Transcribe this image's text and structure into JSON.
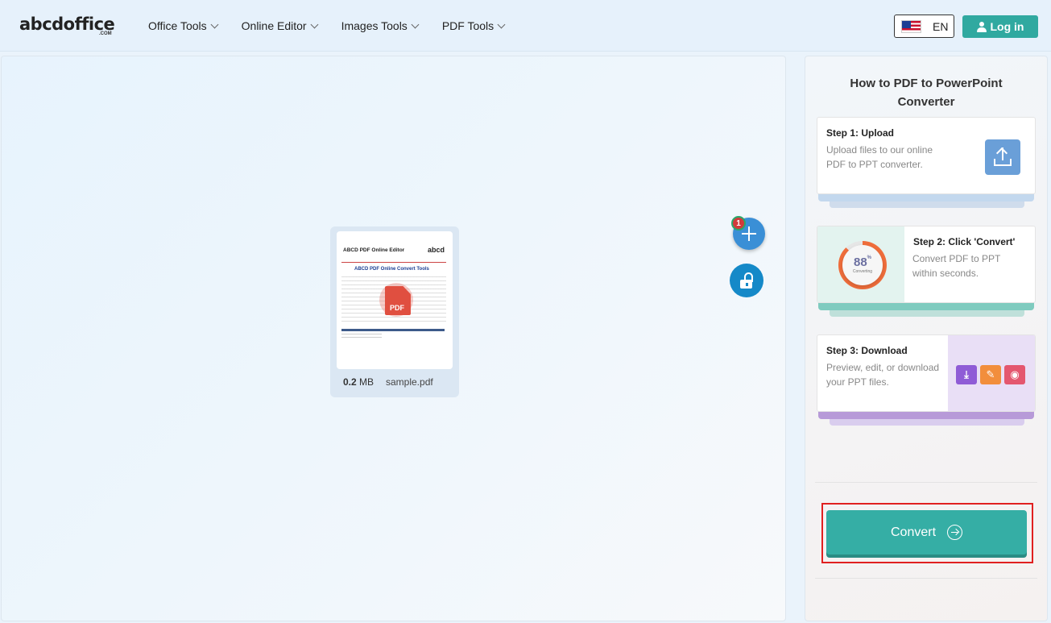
{
  "header": {
    "logo": "abcdoffice",
    "logo_suffix": ".COM",
    "nav": [
      "Office Tools",
      "Online Editor",
      "Images Tools",
      "PDF Tools"
    ],
    "language": "EN",
    "login_label": "Log in"
  },
  "workspace": {
    "file": {
      "size_value": "0.2",
      "size_unit": "MB",
      "name": "sample.pdf",
      "badge_label": "PDF",
      "thumbnail": {
        "heading": "ABCD PDF Online Editor",
        "logo": "abcd",
        "subheading": "ABCD PDF Online Convert Tools"
      }
    },
    "file_count_badge": "1",
    "add_icon": "plus-icon",
    "lock_icon": "unlock-icon"
  },
  "sidebar": {
    "title": "How to PDF to PowerPoint Converter",
    "steps": [
      {
        "title": "Step 1: Upload",
        "description": "Upload files to our online PDF to PPT converter.",
        "icon": "upload-icon"
      },
      {
        "title": "Step 2: Click 'Convert'",
        "description": "Convert PDF to PPT within seconds.",
        "progress_value": "88",
        "progress_unit": "%",
        "progress_caption": "Converting"
      },
      {
        "title": "Step 3: Download",
        "description": "Preview, edit, or download your PPT files.",
        "icons": [
          "download-icon",
          "edit-icon",
          "preview-icon"
        ]
      }
    ],
    "convert_label": "Convert"
  },
  "colors": {
    "accent": "#35aea5",
    "login": "#30a9a0",
    "highlight": "#e02020",
    "add_button": "#3a8fd6"
  }
}
